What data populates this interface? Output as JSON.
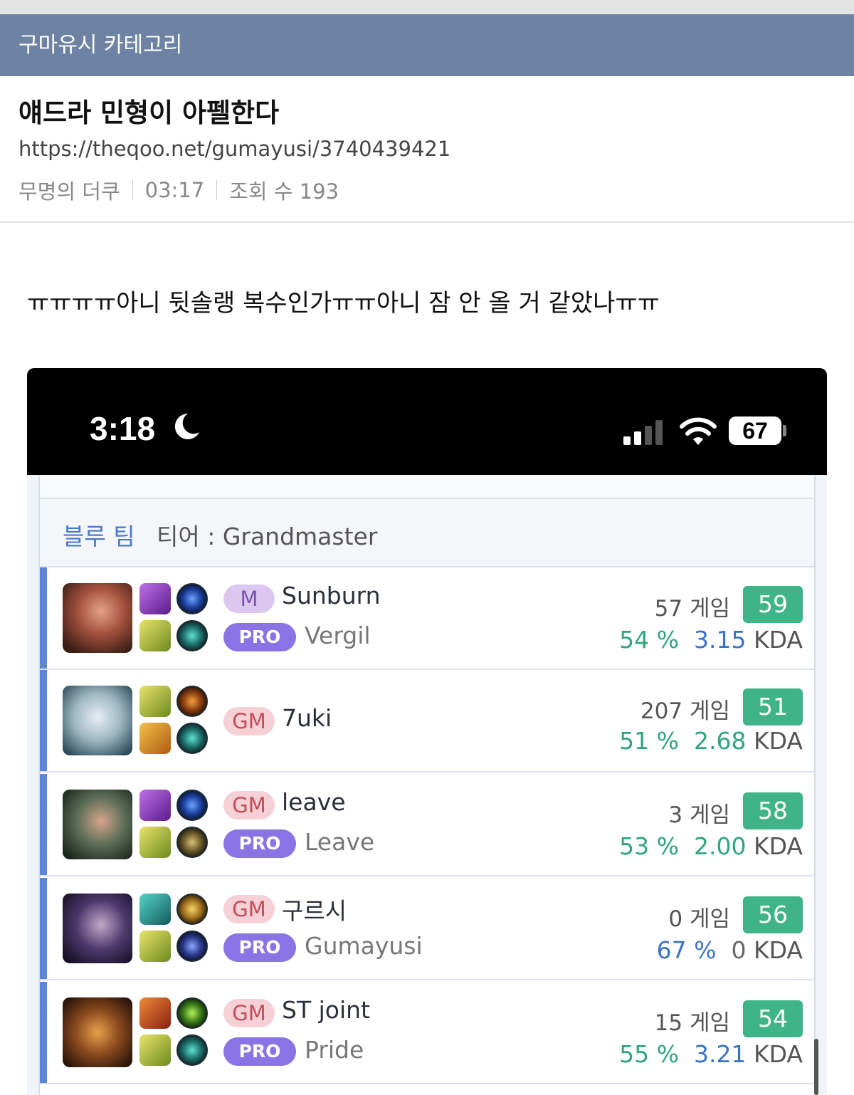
{
  "category": "구마유시 카테고리",
  "post": {
    "title": "얘드라 민형이 아펠한다",
    "url": "https://theqoo.net/gumayusi/3740439421",
    "author": "무명의 더쿠",
    "time": "03:17",
    "views": "조회 수 193",
    "body": "ㅠㅠㅠㅠ아니 뒷솔랭 복수인가ㅠㅠ아니 잠 안 올 거 같았나ㅠㅠ"
  },
  "phone": {
    "clock": "3:18",
    "battery": "67"
  },
  "team": {
    "name": "블루 팀",
    "tier": "티어 : Grandmaster"
  },
  "players": [
    {
      "rank": "M",
      "name": "Sunburn",
      "pro_badge": "PRO",
      "pro_name": "Vergil",
      "games": "57 게임",
      "score": "59",
      "winrate": "54 %",
      "kda": "3.15",
      "kda_label": "KDA"
    },
    {
      "rank": "GM",
      "name": "7uki",
      "pro_badge": "",
      "pro_name": "",
      "games": "207 게임",
      "score": "51",
      "winrate": "51 %",
      "kda": "2.68",
      "kda_label": "KDA"
    },
    {
      "rank": "GM",
      "name": "leave",
      "pro_badge": "PRO",
      "pro_name": "Leave",
      "games": "3 게임",
      "score": "58",
      "winrate": "53 %",
      "kda": "2.00",
      "kda_label": "KDA"
    },
    {
      "rank": "GM",
      "name": "구르시",
      "pro_badge": "PRO",
      "pro_name": "Gumayusi",
      "games": "0 게임",
      "score": "56",
      "winrate": "67 %",
      "kda": "0",
      "kda_label": "KDA"
    },
    {
      "rank": "GM",
      "name": "ST joint",
      "pro_badge": "PRO",
      "pro_name": "Pride",
      "games": "15 게임",
      "score": "54",
      "winrate": "55 %",
      "kda": "3.21",
      "kda_label": "KDA"
    }
  ]
}
